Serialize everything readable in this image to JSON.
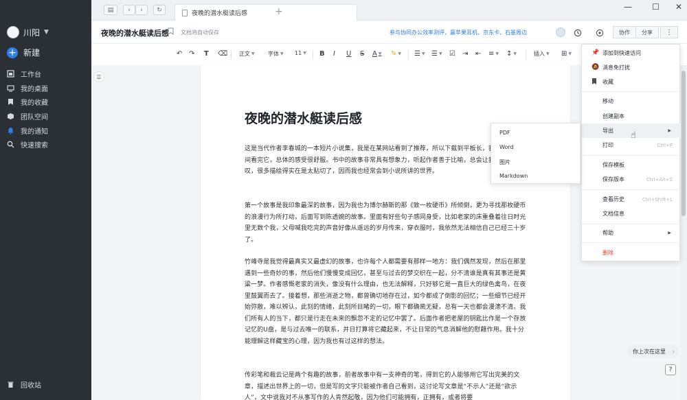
{
  "sidebar": {
    "user_name": "川阳",
    "new_label": "新建",
    "items": [
      {
        "label": "工作台",
        "icon": "workbench-icon"
      },
      {
        "label": "我的桌面",
        "icon": "desktop-icon"
      },
      {
        "label": "我的收藏",
        "icon": "bookmark-icon"
      },
      {
        "label": "团队空间",
        "icon": "team-icon"
      },
      {
        "label": "我的通知",
        "icon": "bell-icon"
      },
      {
        "label": "快速搜索",
        "icon": "search-icon"
      }
    ],
    "recycle_label": "回收站"
  },
  "tabbar": {
    "tab_title": "夜晚的潜水艇读后感"
  },
  "header": {
    "doc_title": "夜晚的潜水艇读后感",
    "autosave": "文档将自动保存",
    "promo": "参与协同办公效率测评，赢苹果耳机、京东卡、石墨周边",
    "collab_label": "协作",
    "share_label": "分享"
  },
  "toolbar": {
    "style_label": "正文",
    "font_label": "字体",
    "size_label": "11",
    "insert_label": "插入"
  },
  "document": {
    "title": "夜晚的潜水艇读后感",
    "paragraphs": [
      "这是当代作者李春城的一本短片小说集，我是在某网站看到了推荐，所以下载到平板长，我花了几天时间看完它，总体的感受很舒服。书中的故事非常具有想象力，听起作者善于比喻，总会让我不由得赞叹，很多描绘得实在是太贴切了，因而我也经常会到小说所讲的世界。",
      "第一个故事是我印象最深的故事，因为我也为博尔赫斯的那《致一枚硬币》所倾倒，更为寻找那枚硬币的浪漫行为所打动，后面写到陈透婉的故事。里面有好些句子感同身受，比如老家的床重叠着往日时光里无数个我，父母喊我吃完的声音好像从遥远的岁月传来，穿衣服时，我依然无法相信自己已经三十岁了。",
      "竹峰寺是我觉得最真实又最虚幻的故事，也许每个人都需要有那样一地方：我们偶然发现，然后在那里遇到一些奇妙的事，然后他们慢慢变成回忆，甚至与过去的梦交织在一起，分不清谁是真有其事还是黄粱一梦。作者感慨老家的消失，像没有什么理由，也无法解释，只好够它是一直巨大的绿色禽鸟，在夜里鼓翼而去了。接着想，那些消逝之物，都曾确切地存在过，如今都成了倒影的回忆；一些细节已经开始弥散，难以辨认，此刻的情绪，此刻所目睹的一切，眼下都确凿无疑，总有一天也都会漫漶不清。我们所有人的当下，都只是行走在未来的飘忽不定的记忆中罢了。后面作者把老屋的钥匙比作是一个存放记忆的U盘，是与过去唯一的联系，并日打算将它藏起来，不让日常的气息消解他的慰藉作用。我十分能理解这样藏宝的心理，因为我也有过这样的想法。",
      "传彩笔和裁云记是两个有趣的故事，前者故事中有一支神奇的笔，得到它的人能够用它写出完美的文章，描述出世界上的一切，但是写的文字只能被作者自己看到，这讨论写文章是“不示人”还是“欲示人”，文中说我对不从事写作的人肯然起敬，因为他们可能拥有，正拥有，或者将要"
    ]
  },
  "menu": {
    "items": [
      {
        "label": "添加到快速访问",
        "icon": "pin-icon"
      },
      {
        "label": "消息免打扰",
        "icon": "mute-icon"
      },
      {
        "label": "收藏",
        "icon": "bookmark-icon"
      },
      {
        "label": "移动"
      },
      {
        "label": "创建副本"
      },
      {
        "label": "导出"
      },
      {
        "label": "打印",
        "shortcut": "Ctrl+P"
      },
      {
        "label": "保存模板"
      },
      {
        "label": "保存版本",
        "shortcut": "Ctrl+Alt+S"
      },
      {
        "label": "查看历史",
        "shortcut": "Ctrl+Shift+L"
      },
      {
        "label": "文档信息"
      },
      {
        "label": "帮助"
      },
      {
        "label": "删除"
      }
    ]
  },
  "export_submenu": [
    "PDF",
    "Word",
    "图片",
    "Markdown"
  ],
  "bottom": {
    "last_position": "你上次在这里"
  },
  "colors": {
    "sidebar_bg": "#2b2f36",
    "accent": "#2f7fe8",
    "danger": "#e0463a"
  }
}
